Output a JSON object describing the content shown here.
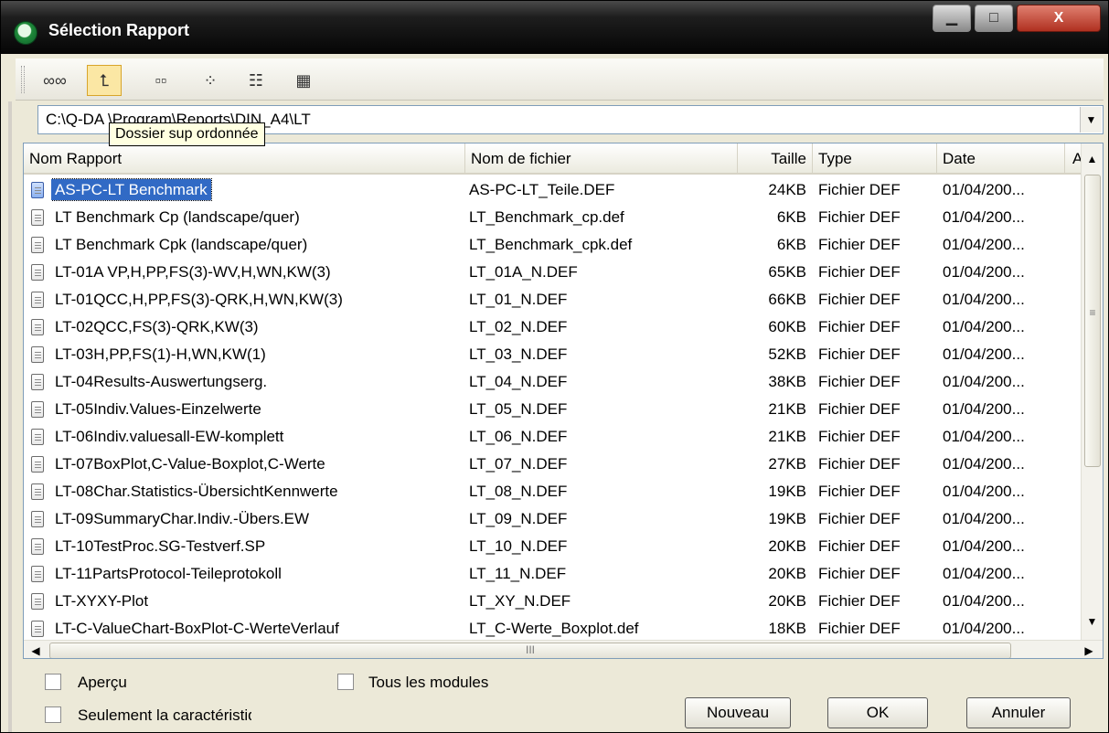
{
  "window": {
    "title": "Sélection Rapport",
    "min_label": "▁",
    "max_label": "□",
    "close_label": "X"
  },
  "toolbar": {
    "buttons": [
      {
        "icon": "glasses-icon",
        "glyph": "∞∞"
      },
      {
        "icon": "folder-up-icon",
        "glyph": "⮤"
      },
      {
        "icon": "large-icons-view-icon",
        "glyph": "▫▫"
      },
      {
        "icon": "small-icons-view-icon",
        "glyph": "⁘"
      },
      {
        "icon": "list-view-icon",
        "glyph": "☷"
      },
      {
        "icon": "details-view-icon",
        "glyph": "▦"
      }
    ]
  },
  "path": {
    "value": "C:\\Q-DA               \\Program\\Reports\\DIN_A4\\LT"
  },
  "tooltip": "Dossier sup ordonnée",
  "columns": [
    "Nom Rapport",
    "Nom de fichier",
    "Taille",
    "Type",
    "Date",
    "A"
  ],
  "rows": [
    {
      "name": "AS-PC-LT Benchmark",
      "file": "AS-PC-LT_Teile.DEF",
      "size": "24KB",
      "type": "Fichier DEF",
      "date": "01/04/200..."
    },
    {
      "name": "LT Benchmark Cp (landscape/quer)",
      "file": "LT_Benchmark_cp.def",
      "size": "6KB",
      "type": "Fichier DEF",
      "date": "01/04/200..."
    },
    {
      "name": "LT Benchmark Cpk (landscape/quer)",
      "file": "LT_Benchmark_cpk.def",
      "size": "6KB",
      "type": "Fichier DEF",
      "date": "01/04/200..."
    },
    {
      "name": "LT-01A VP,H,PP,FS(3)-WV,H,WN,KW(3)",
      "file": "LT_01A_N.DEF",
      "size": "65KB",
      "type": "Fichier DEF",
      "date": "01/04/200..."
    },
    {
      "name": "LT-01QCC,H,PP,FS(3)-QRK,H,WN,KW(3)",
      "file": "LT_01_N.DEF",
      "size": "66KB",
      "type": "Fichier DEF",
      "date": "01/04/200..."
    },
    {
      "name": "LT-02QCC,FS(3)-QRK,KW(3)",
      "file": "LT_02_N.DEF",
      "size": "60KB",
      "type": "Fichier DEF",
      "date": "01/04/200..."
    },
    {
      "name": "LT-03H,PP,FS(1)-H,WN,KW(1)",
      "file": "LT_03_N.DEF",
      "size": "52KB",
      "type": "Fichier DEF",
      "date": "01/04/200..."
    },
    {
      "name": "LT-04Results-Auswertungserg.",
      "file": "LT_04_N.DEF",
      "size": "38KB",
      "type": "Fichier DEF",
      "date": "01/04/200..."
    },
    {
      "name": "LT-05Indiv.Values-Einzelwerte",
      "file": "LT_05_N.DEF",
      "size": "21KB",
      "type": "Fichier DEF",
      "date": "01/04/200..."
    },
    {
      "name": "LT-06Indiv.valuesall-EW-komplett",
      "file": "LT_06_N.DEF",
      "size": "21KB",
      "type": "Fichier DEF",
      "date": "01/04/200..."
    },
    {
      "name": "LT-07BoxPlot,C-Value-Boxplot,C-Werte",
      "file": "LT_07_N.DEF",
      "size": "27KB",
      "type": "Fichier DEF",
      "date": "01/04/200..."
    },
    {
      "name": "LT-08Char.Statistics-ÜbersichtKennwerte",
      "file": "LT_08_N.DEF",
      "size": "19KB",
      "type": "Fichier DEF",
      "date": "01/04/200..."
    },
    {
      "name": "LT-09SummaryChar.Indiv.-Übers.EW",
      "file": "LT_09_N.DEF",
      "size": "19KB",
      "type": "Fichier DEF",
      "date": "01/04/200..."
    },
    {
      "name": "LT-10TestProc.SG-Testverf.SP",
      "file": "LT_10_N.DEF",
      "size": "20KB",
      "type": "Fichier DEF",
      "date": "01/04/200..."
    },
    {
      "name": "LT-11PartsProtocol-Teileprotokoll",
      "file": "LT_11_N.DEF",
      "size": "20KB",
      "type": "Fichier DEF",
      "date": "01/04/200..."
    },
    {
      "name": "LT-XYXY-Plot",
      "file": "LT_XY_N.DEF",
      "size": "20KB",
      "type": "Fichier DEF",
      "date": "01/04/200..."
    },
    {
      "name": "LT-C-ValueChart-BoxPlot-C-WerteVerlauf",
      "file": "LT_C-Werte_Boxplot.def",
      "size": "18KB",
      "type": "Fichier DEF",
      "date": "01/04/200..."
    }
  ],
  "scrollbar": {
    "grip": "≡",
    "hgrip": "III",
    "up": "▲",
    "down": "▼",
    "left": "◀",
    "right": "▶"
  },
  "options": {
    "apercu": "Aperçu",
    "tous_modules": "Tous les modules",
    "seulement": "Seulement la caractéristique en c"
  },
  "buttons": {
    "nouveau": "Nouveau",
    "ok": "OK",
    "annuler": "Annuler"
  },
  "path_drop": "▼"
}
